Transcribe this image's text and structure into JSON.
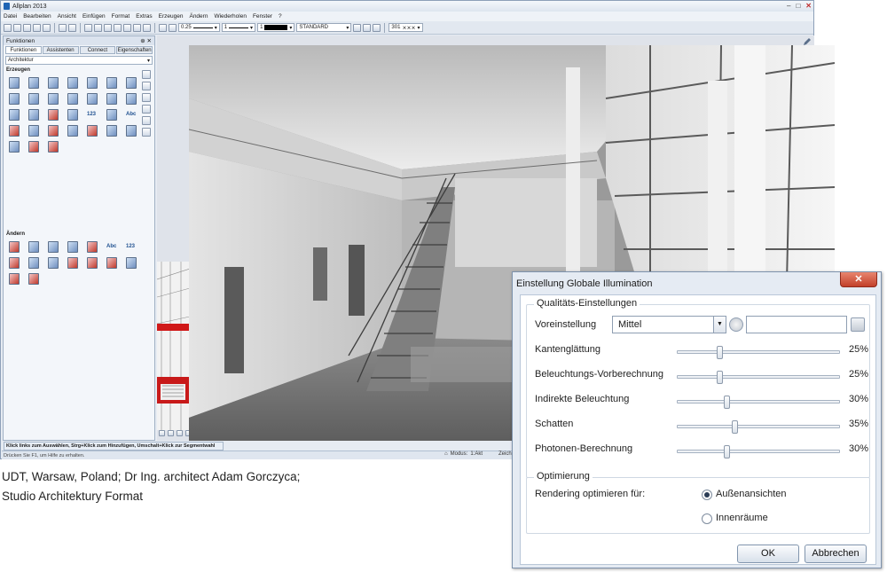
{
  "app": {
    "title": "Allplan 2013",
    "menu": [
      "Datei",
      "Bearbeiten",
      "Ansicht",
      "Einfügen",
      "Format",
      "Extras",
      "Erzeugen",
      "Ändern",
      "Wiederholen",
      "Fenster",
      "?"
    ],
    "toolbar": {
      "pen": "0.25",
      "line": "1",
      "color": "1",
      "layer": "STANDARD",
      "pattern": "301"
    }
  },
  "palette": {
    "title": "Funktionen",
    "tabs": [
      "Funktionen",
      "Assistenten",
      "Connect",
      "Eigenschaften"
    ],
    "module": "Architektur",
    "section_create": "Erzeugen",
    "section_modify": "Ändern"
  },
  "status": {
    "hint": "Klick links zum Auswählen, Strg+Klick zum Hinzufügen, Umschalt+Klick zur Segmentwahl",
    "help": "Drücken Sie F1, um Hilfe zu erhalten.",
    "mode_label": "Modus:",
    "mode_value": "1:Akt",
    "drawing": "Zeich"
  },
  "caption": {
    "line1": "UDT, Warsaw, Poland; Dr Ing. architect Adam Gorczyca;",
    "line2": "Studio Architektury Format"
  },
  "dialog": {
    "title": "Einstellung Globale Illumination",
    "close": "✕",
    "quality_group": "Qualitäts-Einstellungen",
    "preset_label": "Voreinstellung",
    "preset_value": "Mittel",
    "settings": [
      {
        "label": "Kantenglättung",
        "value": 25,
        "display": "25%"
      },
      {
        "label": "Beleuchtungs-Vorberechnung",
        "value": 25,
        "display": "25%"
      },
      {
        "label": "Indirekte Beleuchtung",
        "value": 30,
        "display": "30%"
      },
      {
        "label": "Schatten",
        "value": 35,
        "display": "35%"
      },
      {
        "label": "Photonen-Berechnung",
        "value": 30,
        "display": "30%"
      }
    ],
    "optimize_group": "Optimierung",
    "optimize_label": "Rendering optimieren für:",
    "options": [
      {
        "label": "Außenansichten",
        "selected": true
      },
      {
        "label": "Innenräume",
        "selected": false
      }
    ],
    "ok": "OK",
    "cancel": "Abbrechen"
  }
}
